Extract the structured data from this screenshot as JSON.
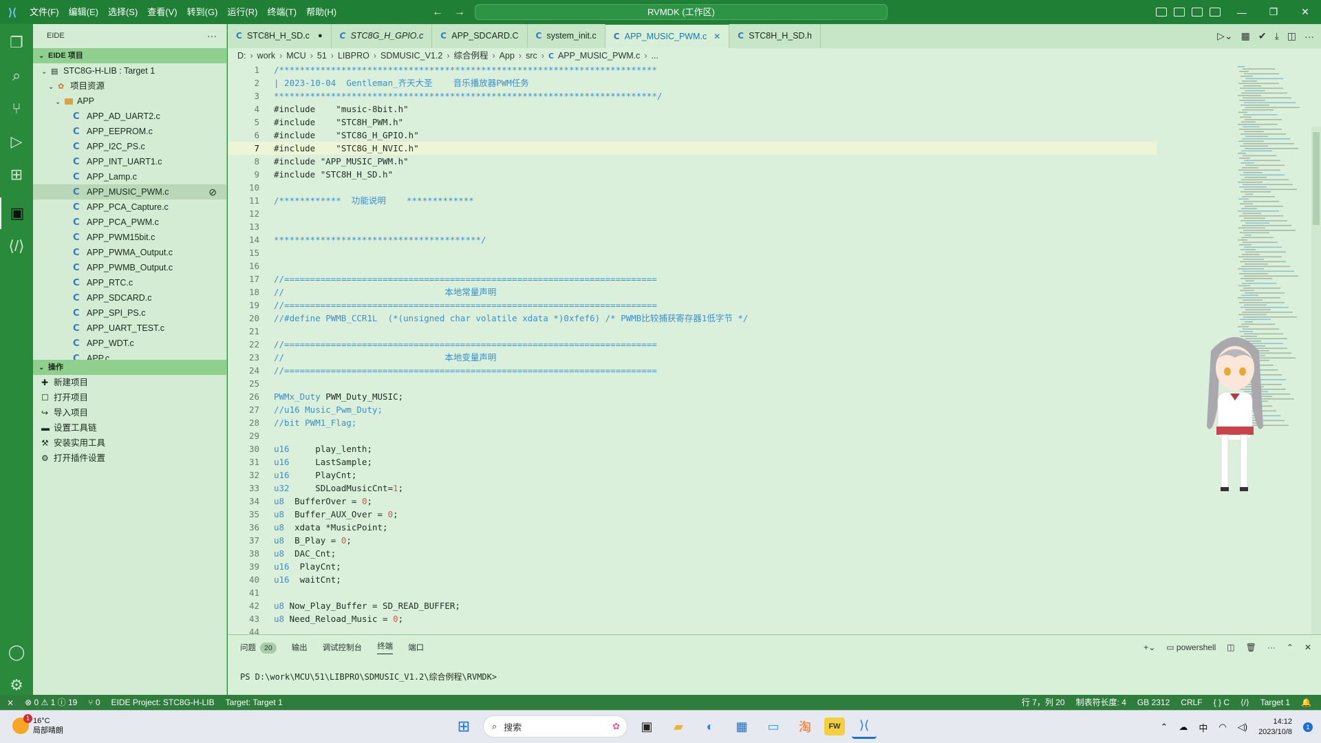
{
  "titlebar": {
    "menus": [
      "文件(F)",
      "编辑(E)",
      "选择(S)",
      "查看(V)",
      "转到(G)",
      "运行(R)",
      "终端(T)",
      "帮助(H)"
    ],
    "command_center": "RVMDK (工作区)"
  },
  "sidebar": {
    "header": "EIDE",
    "section_title": "EIDE 项目",
    "project": "STC8G-H-LIB : Target 1",
    "group": "项目资源",
    "folder": "APP",
    "files": [
      "APP_AD_UART2.c",
      "APP_EEPROM.c",
      "APP_I2C_PS.c",
      "APP_INT_UART1.c",
      "APP_Lamp.c",
      "APP_MUSIC_PWM.c",
      "APP_PCA_Capture.c",
      "APP_PCA_PWM.c",
      "APP_PWM15bit.c",
      "APP_PWMA_Output.c",
      "APP_PWMB_Output.c",
      "APP_RTC.c",
      "APP_SDCARD.c",
      "APP_SPI_PS.c",
      "APP_UART_TEST.c",
      "APP_WDT.c",
      "APP.c"
    ],
    "selected_file": "APP_MUSIC_PWM.c",
    "ops_title": "操作",
    "ops": [
      "新建项目",
      "打开项目",
      "导入项目",
      "设置工具链",
      "安装实用工具",
      "打开插件设置"
    ]
  },
  "tabs": [
    {
      "label": "STC8H_H_SD.c",
      "state": "dirty"
    },
    {
      "label": "STC8G_H_GPIO.c",
      "state": "italic"
    },
    {
      "label": "APP_SDCARD.C",
      "state": ""
    },
    {
      "label": "system_init.c",
      "state": ""
    },
    {
      "label": "APP_MUSIC_PWM.c",
      "state": "active"
    },
    {
      "label": "STC8H_H_SD.h",
      "state": ""
    }
  ],
  "breadcrumb": [
    "D:",
    "work",
    "MCU",
    "51",
    "LIBPRO",
    "SDMUSIC_V1.2",
    "综合例程",
    "App",
    "src",
    "APP_MUSIC_PWM.c",
    "..."
  ],
  "editor": {
    "current_line": 7,
    "lines": [
      "/*************************************************************************",
      "| 2023-10-04  Gentleman_齐天大圣    音乐播放器PWM任务",
      "**************************************************************************/",
      "#include    \"music-8bit.h\"",
      "#include    \"STC8H_PWM.h\"",
      "#include    \"STC8G_H_GPIO.h\"",
      "#include    \"STC8G_H_NVIC.h\"",
      "#include \"APP_MUSIC_PWM.h\"",
      "#include \"STC8H_H_SD.h\"",
      "",
      "/************  功能说明    *************",
      "",
      "",
      "****************************************/",
      "",
      "",
      "//========================================================================",
      "//                               本地常量声明",
      "//========================================================================",
      "//#define PWMB_CCR1L  (*(unsigned char volatile xdata *)0xfef6) /* PWMB比较捕获寄存器1低字节 */",
      "",
      "//========================================================================",
      "//                               本地变量声明",
      "//========================================================================",
      "",
      "PWMx_Duty PWM_Duty_MUSIC;",
      "//u16 Music_Pwm_Duty;",
      "//bit PWM1_Flag;",
      "",
      "u16     play_lenth;",
      "u16     LastSample;",
      "u16     PlayCnt;",
      "u32     SDLoadMusicCnt=1;",
      "u8  BufferOver = 0;",
      "u8  Buffer_AUX_Over = 0;",
      "u8  xdata *MusicPoint;",
      "u8  B_Play = 0;",
      "u8  DAC_Cnt;",
      "u16  PlayCnt;",
      "u16  waitCnt;",
      "",
      "u8 Now_Play_Buffer = SD_READ_BUFFER;",
      "u8 Need_Reload_Music = 0;",
      ""
    ]
  },
  "panel": {
    "tabs": [
      "问题",
      "输出",
      "调试控制台",
      "终端",
      "端口"
    ],
    "problems_count": "20",
    "active_tab": "终端",
    "shell": "powershell",
    "prompt": "PS D:\\work\\MCU\\51\\LIBPRO\\SDMUSIC_V1.2\\综合例程\\RVMDK>"
  },
  "statusbar": {
    "errors": "0",
    "warnings": "1",
    "infos": "19",
    "ports": "0",
    "project": "EIDE Project: STC8G-H-LIB",
    "target": "Target: Target 1",
    "cursor": "行 7，列 20",
    "tab_size": "制表符长度: 4",
    "encoding": "GB 2312",
    "eol": "CRLF",
    "language": "C",
    "target_right": "Target 1"
  },
  "taskbar": {
    "temp": "16°C",
    "weather": "局部晴朗",
    "weather_badge": "1",
    "search": "搜索",
    "ime": "中",
    "time": "14:12",
    "date": "2023/10/8",
    "notif_count": "1"
  },
  "colors": {
    "accent": "#2a8a3c",
    "editor_bg": "#dbf0db",
    "keyword": "#3a8fd0",
    "number": "#d9534f"
  }
}
